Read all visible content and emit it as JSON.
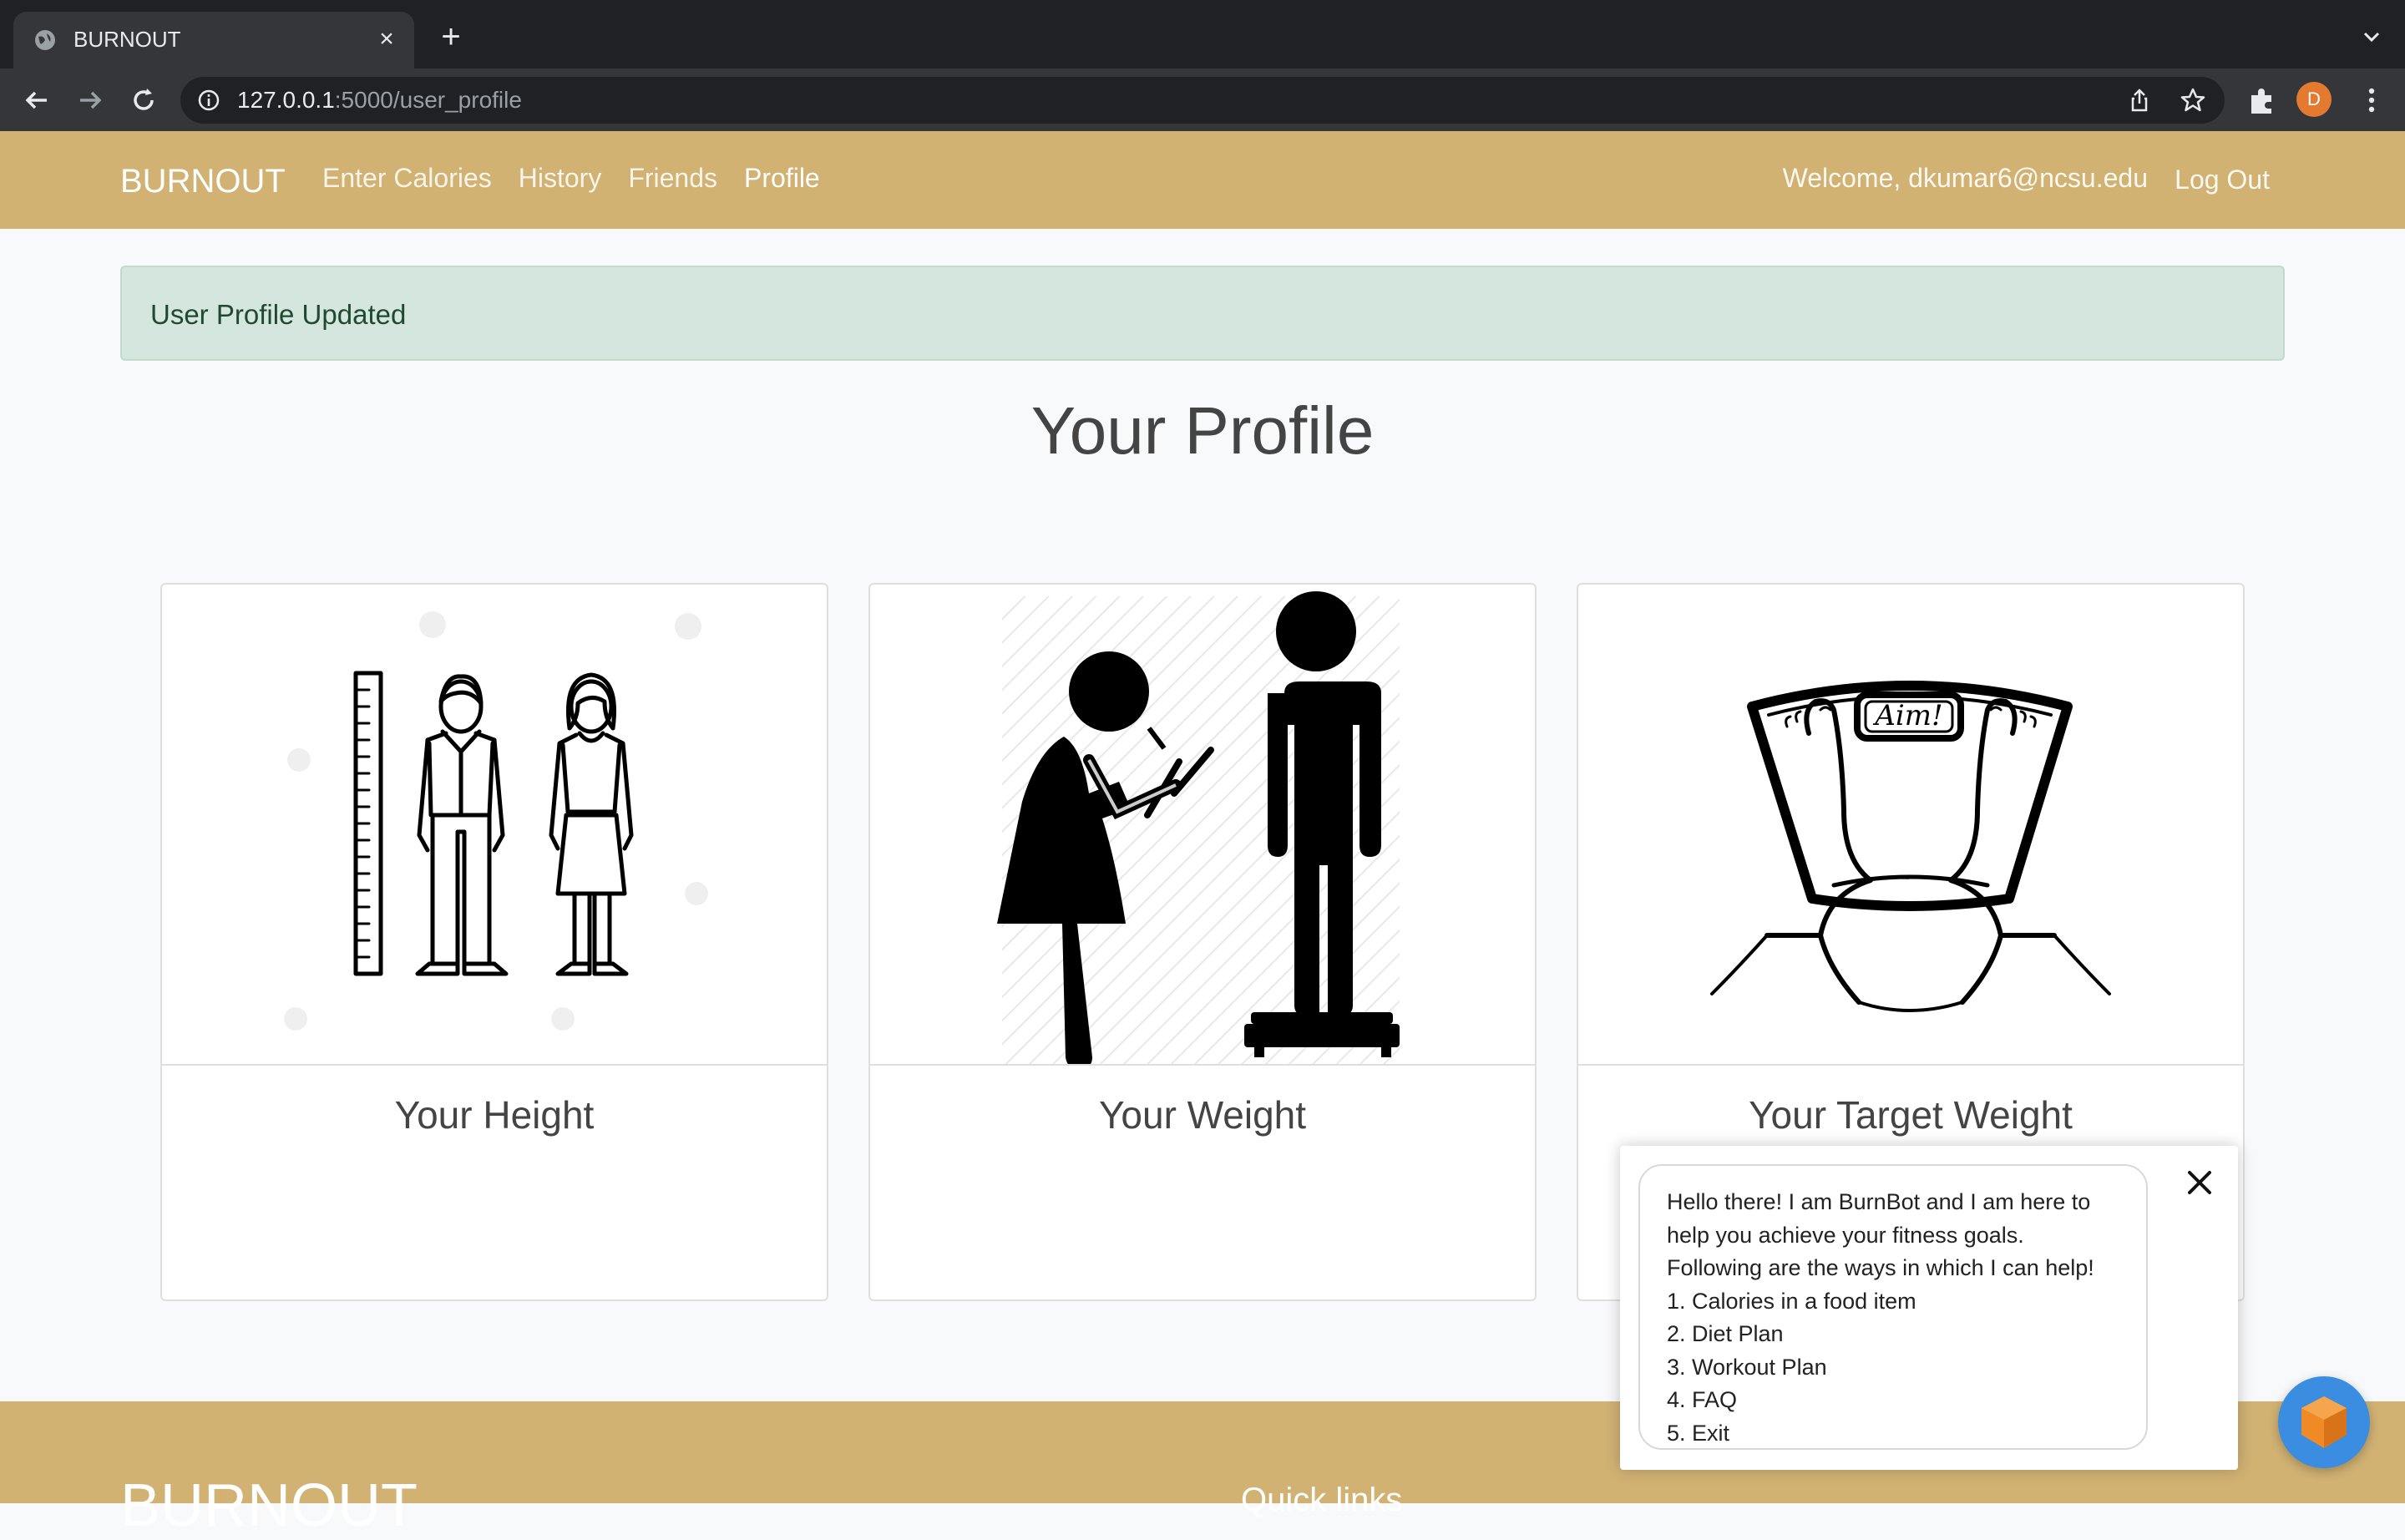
{
  "browser": {
    "tab_title": "BURNOUT",
    "url_host": "127.0.0.1",
    "url_rest": ":5000/user_profile",
    "avatar_letter": "D"
  },
  "navbar": {
    "brand": "BURNOUT",
    "links": [
      "Enter Calories",
      "History",
      "Friends",
      "Profile"
    ],
    "active_link": "Profile",
    "welcome": "Welcome, dkumar6@ncsu.edu",
    "logout": "Log Out"
  },
  "alert": {
    "message": "User Profile Updated"
  },
  "page": {
    "title": "Your Profile"
  },
  "cards": [
    {
      "label": "Your Height",
      "image": "height-chart-illustration"
    },
    {
      "label": "Your Weight",
      "image": "weighing-person-illustration"
    },
    {
      "label": "Your Target Weight",
      "image": "scale-aim-illustration"
    }
  ],
  "scale_text": "Aim!",
  "footer": {
    "brand": "BURNOUT",
    "quick_links": "Quick links"
  },
  "chatbot": {
    "lines": [
      "Hello there! I am BurnBot and I am here to",
      "help you achieve your fitness goals.",
      "Following are the ways in which I can help!",
      "1. Calories in a food item",
      "2. Diet Plan",
      "3. Workout Plan",
      "4. FAQ",
      "5. Exit"
    ]
  },
  "colors": {
    "brand": "#d1b273",
    "alert_bg": "#d4e6dd",
    "chat_button": "#3a8de0"
  }
}
